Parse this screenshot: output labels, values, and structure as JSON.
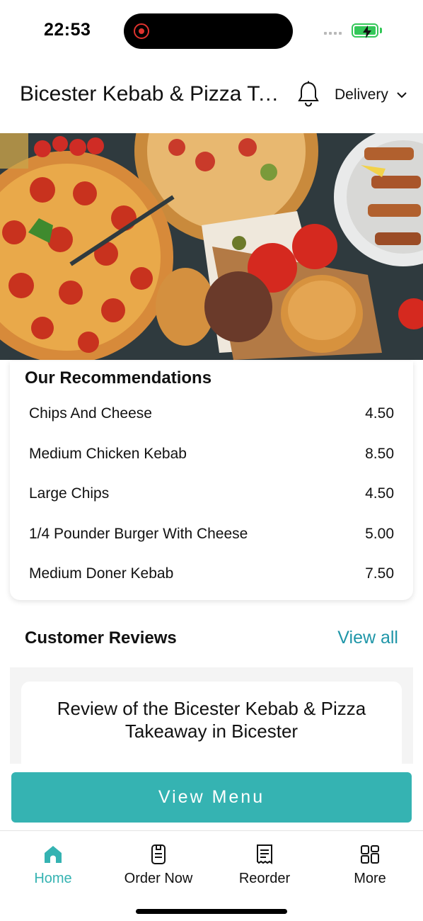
{
  "status_bar": {
    "time": "22:53",
    "recording_icon": "screen-recording-icon",
    "battery_icon": "battery-charging-icon"
  },
  "header": {
    "title": "Bicester Kebab & Pizza Tak...",
    "bell_icon": "bell-icon",
    "order_type": "Delivery",
    "chevron_icon": "chevron-down-icon"
  },
  "hero": {
    "image": "food-banner-pizza-burgers-skewers"
  },
  "recommendations": {
    "title": "Our Recommendations",
    "items": [
      {
        "name": "Chips And Cheese",
        "price": "4.50"
      },
      {
        "name": "Medium Chicken Kebab",
        "price": "8.50"
      },
      {
        "name": "Large Chips",
        "price": "4.50"
      },
      {
        "name": "1/4 Pounder Burger With Cheese",
        "price": "5.00"
      },
      {
        "name": "Medium Doner Kebab",
        "price": "7.50"
      }
    ]
  },
  "reviews": {
    "title": "Customer Reviews",
    "view_all": "View all",
    "card_title": "Review of the Bicester Kebab & Pizza Takeaway in Bicester"
  },
  "cta": {
    "label": "View Menu"
  },
  "bottom_nav": {
    "items": [
      {
        "label": "Home",
        "icon": "home-icon",
        "active": true
      },
      {
        "label": "Order Now",
        "icon": "order-icon",
        "active": false
      },
      {
        "label": "Reorder",
        "icon": "receipt-icon",
        "active": false
      },
      {
        "label": "More",
        "icon": "grid-icon",
        "active": false
      }
    ]
  },
  "colors": {
    "accent": "#35b3b2",
    "link": "#1f96a8",
    "battery": "#34c759",
    "recording": "#e0332e"
  }
}
